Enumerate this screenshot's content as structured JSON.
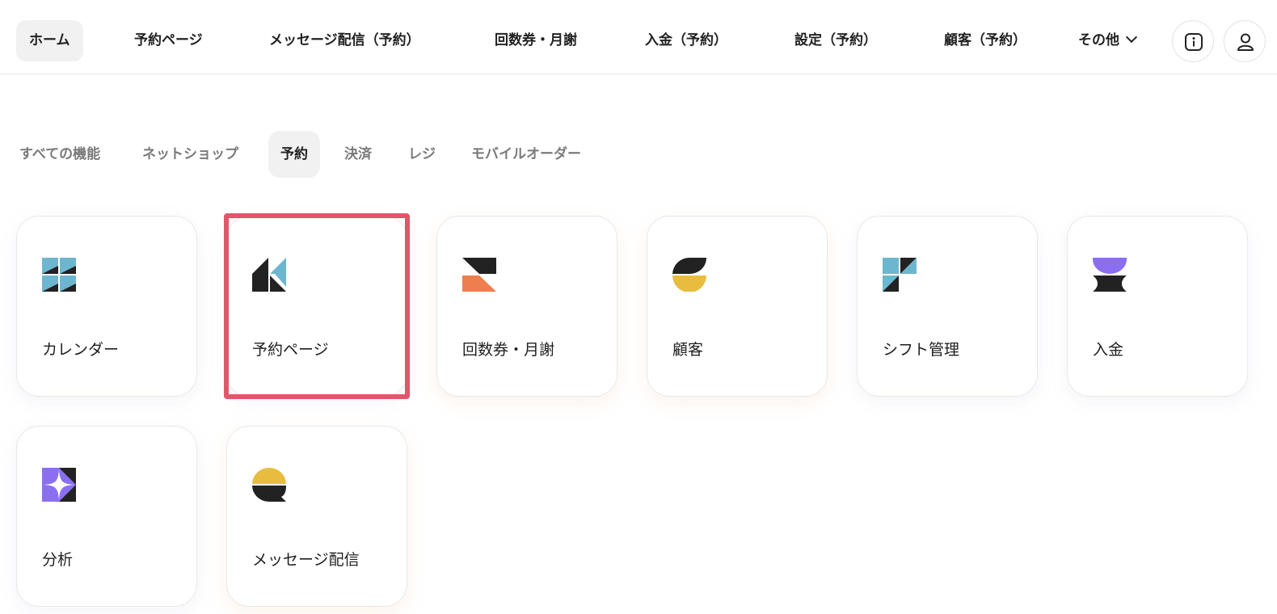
{
  "topnav": {
    "items": [
      {
        "label": "ホーム"
      },
      {
        "label": "予約ページ"
      },
      {
        "label": "メッセージ配信（予約）"
      },
      {
        "label": "回数券・月謝"
      },
      {
        "label": "入金（予約）"
      },
      {
        "label": "設定（予約）"
      },
      {
        "label": "顧客（予約）"
      }
    ],
    "more_label": "その他",
    "info_icon": "info-icon",
    "user_icon": "user-icon"
  },
  "tabs": [
    {
      "label": "すべての機能"
    },
    {
      "label": "ネットショップ"
    },
    {
      "label": "予約"
    },
    {
      "label": "決済"
    },
    {
      "label": "レジ"
    },
    {
      "label": "モバイルオーダー"
    }
  ],
  "cards": [
    {
      "label": "カレンダー",
      "icon": "calendar-icon"
    },
    {
      "label": "予約ページ",
      "icon": "reservation-page-icon"
    },
    {
      "label": "回数券・月謝",
      "icon": "ticket-icon"
    },
    {
      "label": "顧客",
      "icon": "customer-icon"
    },
    {
      "label": "シフト管理",
      "icon": "shift-icon"
    },
    {
      "label": "入金",
      "icon": "deposit-icon"
    },
    {
      "label": "分析",
      "icon": "analytics-icon"
    },
    {
      "label": "メッセージ配信",
      "icon": "message-icon"
    }
  ],
  "colors": {
    "blue": "#6db6cf",
    "dark": "#222222",
    "orange": "#ef7e4e",
    "yellow": "#e8bd3f",
    "purple": "#8b6ff0",
    "highlight": "#e2566a"
  }
}
